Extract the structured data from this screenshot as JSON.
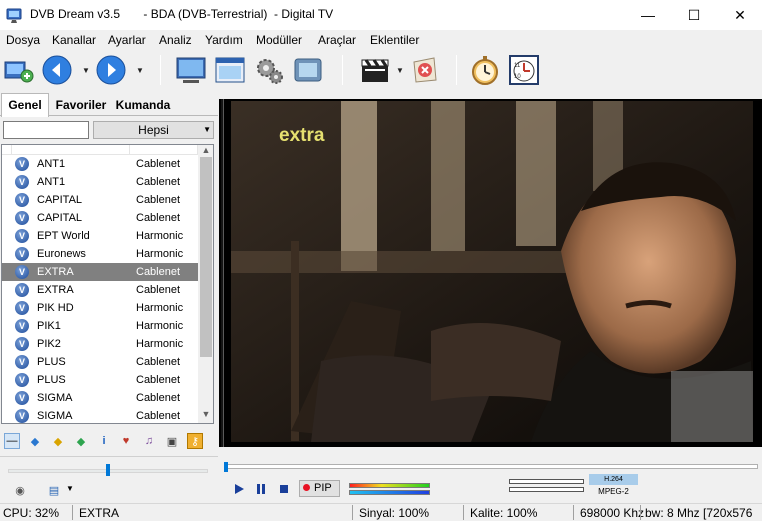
{
  "window": {
    "title": "DVB Dream v3.5       - BDA (DVB-Terrestrial)  - Digital TV",
    "minimize": "—",
    "maximize": "☐",
    "close": "✕"
  },
  "menu": [
    "Dosya",
    "Kanallar",
    "Ayarlar",
    "Analiz",
    "Yardım",
    "Modüller",
    "Araçlar",
    "Eklentiler"
  ],
  "toolbar_icons": [
    "open-channels-icon",
    "back-icon",
    "forward-icon",
    "monitor-icon",
    "window-icon",
    "settings-gears-icon",
    "screenshot-icon",
    "clapperboard-icon",
    "stop-record-icon",
    "timer-clock-icon",
    "scheduler-calendar-icon"
  ],
  "tabs": [
    "Genel",
    "Favoriler",
    "Kumanda"
  ],
  "search": {
    "value": "",
    "filter_selected": "Hepsi"
  },
  "channels": [
    {
      "name": "ANT1",
      "provider": "Cablenet",
      "selected": false
    },
    {
      "name": "ANT1",
      "provider": "Cablenet",
      "selected": false
    },
    {
      "name": "CAPITAL",
      "provider": "Cablenet",
      "selected": false
    },
    {
      "name": "CAPITAL",
      "provider": "Cablenet",
      "selected": false
    },
    {
      "name": "EPT World",
      "provider": "Harmonic",
      "selected": false
    },
    {
      "name": "Euronews",
      "provider": "Harmonic",
      "selected": false
    },
    {
      "name": "EXTRA",
      "provider": "Cablenet",
      "selected": true
    },
    {
      "name": "EXTRA",
      "provider": "Cablenet",
      "selected": false
    },
    {
      "name": "PIK HD",
      "provider": "Harmonic",
      "selected": false
    },
    {
      "name": "PIK1",
      "provider": "Harmonic",
      "selected": false
    },
    {
      "name": "PIK2",
      "provider": "Harmonic",
      "selected": false
    },
    {
      "name": "PLUS",
      "provider": "Cablenet",
      "selected": false
    },
    {
      "name": "PLUS",
      "provider": "Cablenet",
      "selected": false
    },
    {
      "name": "SIGMA",
      "provider": "Cablenet",
      "selected": false
    },
    {
      "name": "SIGMA",
      "provider": "Cablenet",
      "selected": false
    }
  ],
  "video": {
    "channel_logo": "extra"
  },
  "player": {
    "pip_label": "PIP",
    "codec": "H.264",
    "video_format": "MPEG-2",
    "left_slider_level": 0.5,
    "seek_position": 0.0
  },
  "status": {
    "cpu": "CPU: 32%",
    "channel": "EXTRA",
    "signal": "Sinyal: 100%",
    "quality": "Kalite: 100%",
    "frequency": "698000 Khz",
    "bandwidth": "bw: 8 Mhz [720x576"
  },
  "colors": {
    "selected_row": "#808080",
    "accent": "#0078d7",
    "logo_text": "#e5e070"
  }
}
